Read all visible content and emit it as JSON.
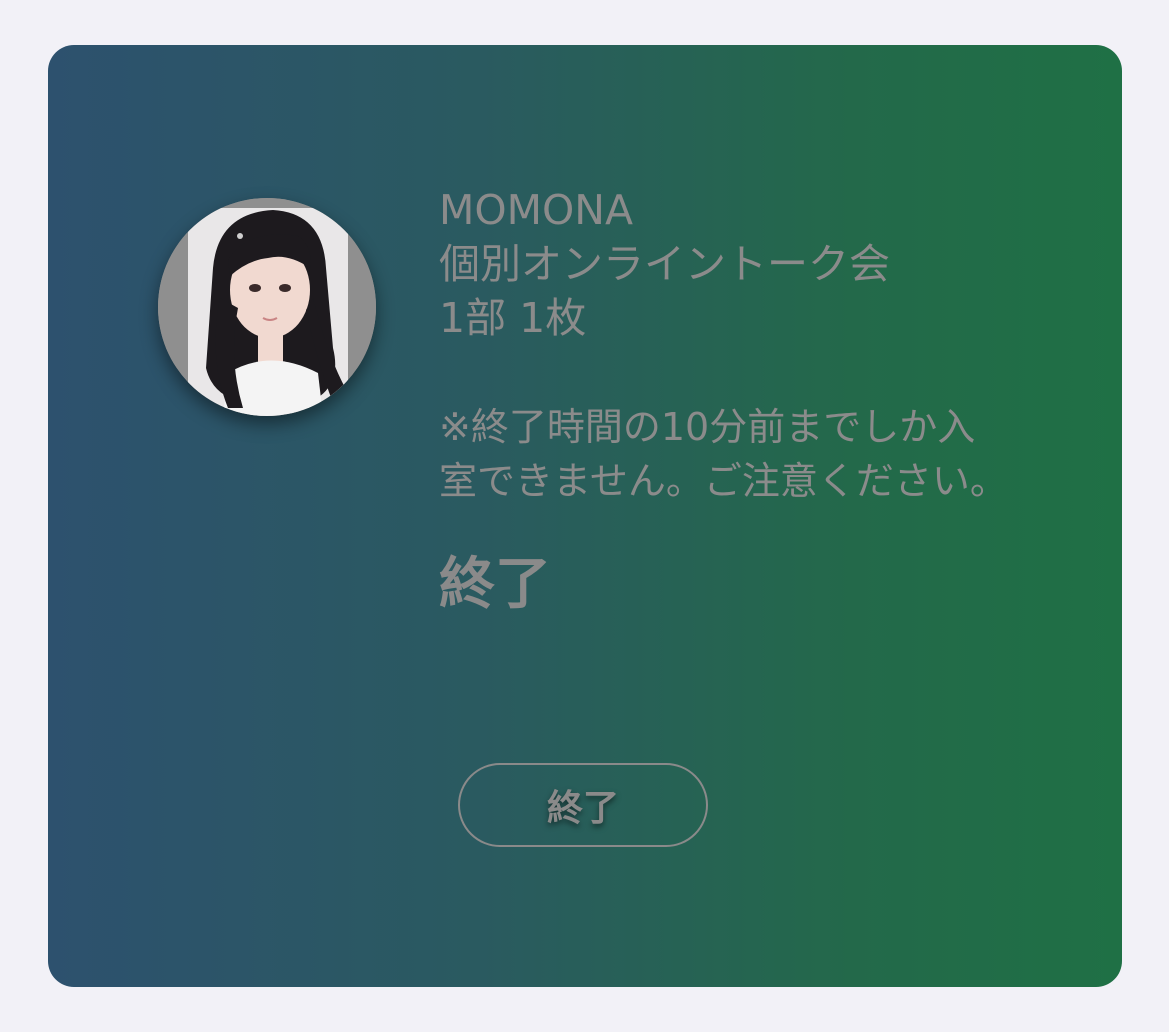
{
  "card": {
    "name": "MOMONA",
    "event": "個別オンライントーク会",
    "ticket": "1部 1枚",
    "note": "※終了時間の10分前までしか入室できません。ご注意ください。",
    "status": "終了",
    "button_label": "終了"
  },
  "colors": {
    "background": "#f2f1f7",
    "gradient_start": "#2d516e",
    "gradient_end": "#1f7045",
    "text": "#8b8b8b"
  },
  "icons": {
    "avatar": "avatar-photo"
  }
}
